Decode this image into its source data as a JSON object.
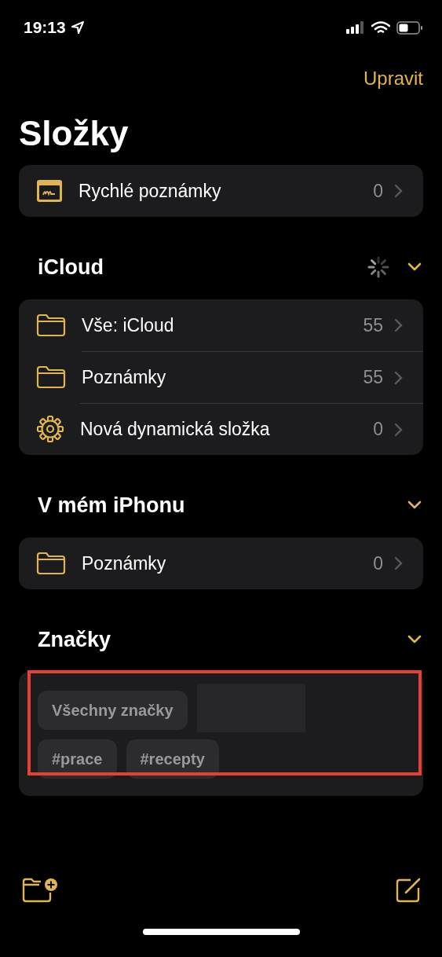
{
  "status_bar": {
    "time": "19:13"
  },
  "nav": {
    "edit_button": "Upravit"
  },
  "title": "Složky",
  "quick_notes": {
    "label": "Rychlé poznámky",
    "count": "0"
  },
  "sections": [
    {
      "title": "iCloud",
      "expanded": true,
      "syncing": true,
      "folders": [
        {
          "kind": "folder",
          "label": "Vše: iCloud",
          "count": "55"
        },
        {
          "kind": "folder",
          "label": "Poznámky",
          "count": "55"
        },
        {
          "kind": "smart",
          "label": "Nová dynamická složka",
          "count": "0"
        }
      ]
    },
    {
      "title": "V mém iPhonu",
      "expanded": true,
      "syncing": false,
      "folders": [
        {
          "kind": "folder",
          "label": "Poznámky",
          "count": "0"
        }
      ]
    }
  ],
  "tags": {
    "title": "Značky",
    "expanded": true,
    "highlighted": true,
    "chips": [
      {
        "kind": "tag",
        "label": "Všechny značky"
      },
      {
        "kind": "redacted"
      },
      {
        "kind": "tag",
        "label": "#prace"
      },
      {
        "kind": "tag",
        "label": "#recepty"
      }
    ]
  }
}
